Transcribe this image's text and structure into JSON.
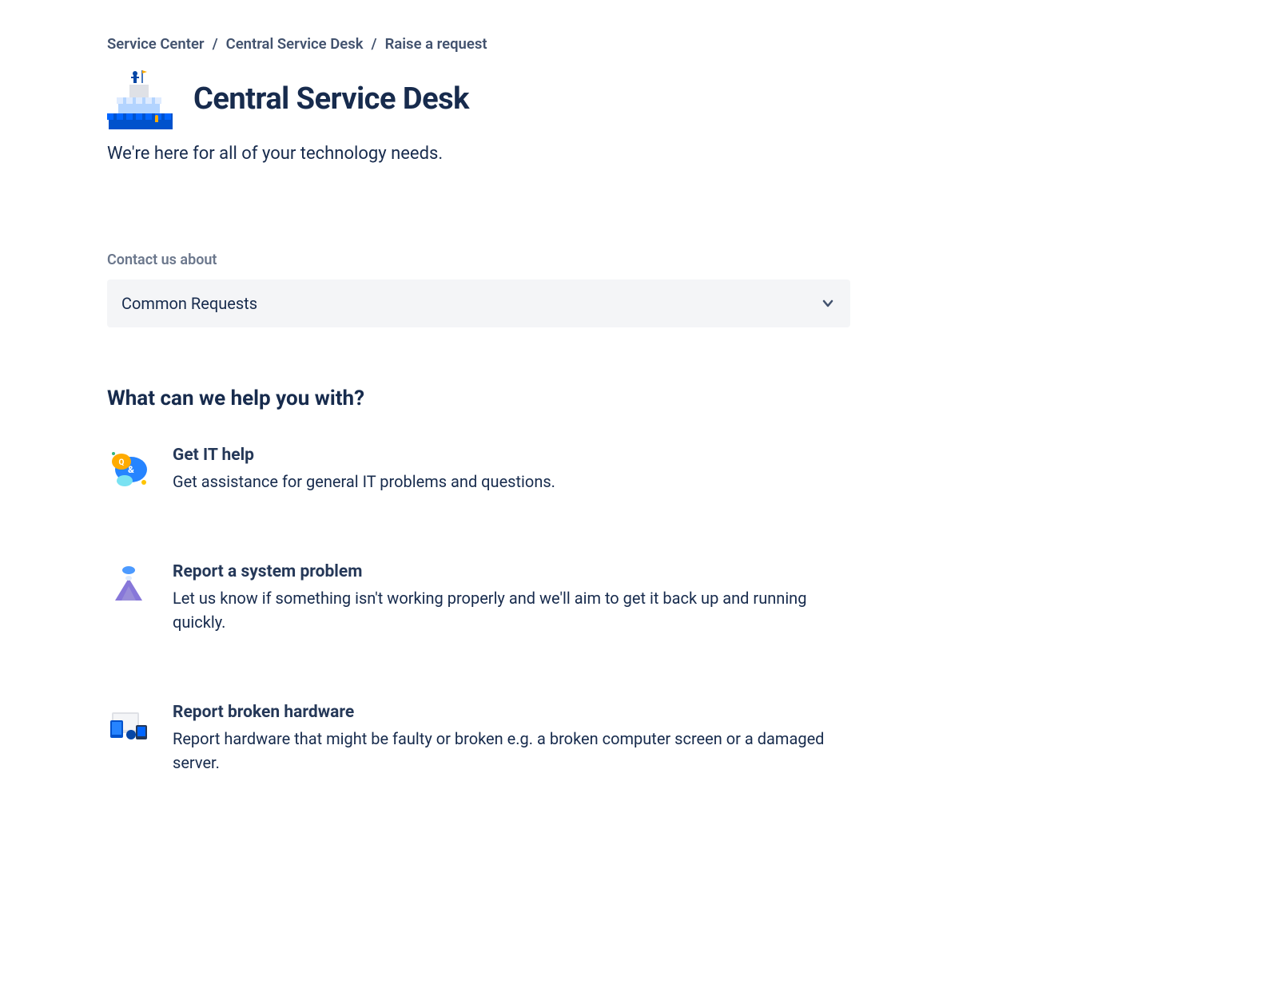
{
  "breadcrumb": {
    "items": [
      {
        "label": "Service Center"
      },
      {
        "label": "Central Service Desk"
      },
      {
        "label": "Raise a request"
      }
    ]
  },
  "header": {
    "title": "Central Service Desk",
    "tagline": "We're here for all of your technology needs."
  },
  "contact": {
    "label": "Contact us about",
    "selected": "Common Requests"
  },
  "help": {
    "heading": "What can we help you with?"
  },
  "requests": [
    {
      "title": "Get IT help",
      "description": "Get assistance for general IT problems and questions.",
      "icon": "chat-bubbles-icon"
    },
    {
      "title": "Report a system problem",
      "description": "Let us know if something isn't working properly and we'll aim to get it back up and running quickly.",
      "icon": "volcano-icon"
    },
    {
      "title": "Report broken hardware",
      "description": "Report hardware that might be faulty or broken e.g. a broken computer screen or a damaged server.",
      "icon": "devices-icon"
    }
  ]
}
